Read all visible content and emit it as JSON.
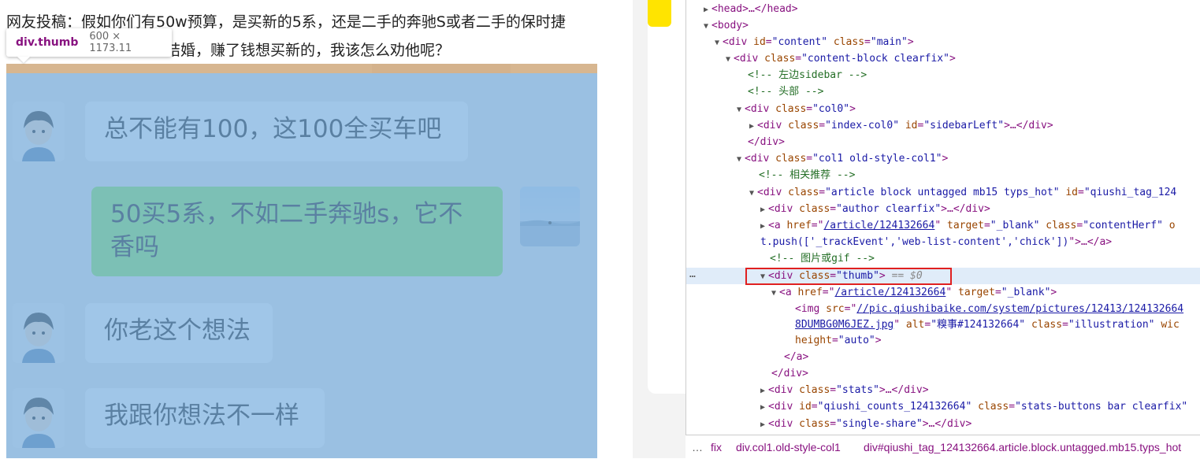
{
  "post": {
    "line1": "网友投稿：假如你们有50w预算，是买新的5系，还是二手的奔驰S或者二手的保时捷",
    "line2": "结婚，赚了钱想买新的，我该怎么劝他呢？"
  },
  "tooltip": {
    "name": "div.thumb",
    "size": "600 × 1173.11"
  },
  "chat": {
    "messages": [
      {
        "side": "left",
        "text": "总不能有100，这100全买车吧"
      },
      {
        "side": "right",
        "text": "50买5系，不如二手奔驰s，它不香吗"
      },
      {
        "side": "left",
        "text": "你老这个想法"
      },
      {
        "side": "left",
        "text": "我跟你想法不一样"
      }
    ]
  },
  "devtools": {
    "lines": {
      "l0": {
        "pre": "<head>…</head>"
      },
      "l1": {
        "pre": "<body>"
      },
      "l2": {
        "tag": "<div ",
        "a1": "id",
        "v1": "\"content\"",
        "a2": "class",
        "v2": "\"main\"",
        "end": ">"
      },
      "l3": {
        "tag": "<div ",
        "a1": "class",
        "v1": "\"content-block clearfix\"",
        "end": ">"
      },
      "l4": {
        "comment": "<!-- 左边sidebar -->"
      },
      "l5": {
        "comment": "<!-- 头部 -->"
      },
      "l6": {
        "tag": "<div ",
        "a1": "class",
        "v1": "\"col0\"",
        "end": ">"
      },
      "l7": {
        "tag": "<div ",
        "a1": "class",
        "v1": "\"index-col0\"",
        "a2": "id",
        "v2": "\"sidebarLeft\"",
        "end": ">…</div>"
      },
      "l8": {
        "pre": "</div>"
      },
      "l9": {
        "tag": "<div ",
        "a1": "class",
        "v1": "\"col1 old-style-col1\"",
        "end": ">"
      },
      "l10": {
        "comment": "<!-- 相关推荐 -->"
      },
      "l11": {
        "tag": "<div ",
        "a1": "class",
        "v1": "\"article block untagged mb15 typs_hot\"",
        "a2": "id",
        "v2": "\"qiushi_tag_124"
      },
      "l12": {
        "tag": "<div ",
        "a1": "class",
        "v1": "\"author clearfix\"",
        "end": ">…</div>"
      },
      "l13": {
        "tag": "<a ",
        "a1": "href",
        "link1": "/article/124132664",
        "a2": "target",
        "v2": "\"_blank\"",
        "a3": "class",
        "v3": "\"contentHerf\"",
        "tail": "o"
      },
      "l14": {
        "text": "t.push(['_trackEvent','web-list-content','chick'])",
        "end": "\">…</a>"
      },
      "l15": {
        "comment": "<!-- 图片或gif -->"
      },
      "l16": {
        "tag": "<div ",
        "a1": "class",
        "v1": "\"thumb\"",
        "end": ">",
        "eq": "== $0"
      },
      "l17": {
        "tag": "<a ",
        "a1": "href",
        "link1": "/article/124132664",
        "a2": "target",
        "v2": "\"_blank\"",
        "end": ">"
      },
      "l18": {
        "tag": "<img ",
        "a1": "src",
        "link1": "//pic.qiushibaike.com/system/pictures/12413/124132664"
      },
      "l19": {
        "link1": "8DUMBG0M6JEZ.jpg",
        "a2": "alt",
        "v2": "\"糗事#124132664\"",
        "a3": "class",
        "v3": "\"illustration\"",
        "tail": "wic"
      },
      "l20": {
        "a1": "height",
        "v1": "\"auto\"",
        "end": ">"
      },
      "l21": {
        "pre": "</a>"
      },
      "l22": {
        "pre": "</div>"
      },
      "l23": {
        "tag": "<div ",
        "a1": "class",
        "v1": "\"stats\"",
        "end": ">…</div>"
      },
      "l24": {
        "tag": "<div ",
        "a1": "id",
        "v1": "\"qiushi_counts_124132664\"",
        "a2": "class",
        "v2": "\"stats-buttons bar clearfix\""
      },
      "l25": {
        "tag": "<div ",
        "a1": "class",
        "v1": "\"single-share\"",
        "end": ">…</div>"
      }
    },
    "selection_dots": "…",
    "breadcrumb": {
      "dots": "…",
      "items": [
        "fix",
        "div.col1.old-style-col1",
        "div#qiushi_tag_124132664.article.block.untagged.mb15.typs_hot"
      ]
    }
  },
  "colors": {
    "highlight_content": "#6fa8dc",
    "highlight_padding": "#f6b26b",
    "selection_box": "#e02020",
    "selected_row": "#e0ecf9",
    "tag": "#881280",
    "attr": "#994500",
    "value": "#1a1aa6",
    "comment": "#236e25"
  }
}
